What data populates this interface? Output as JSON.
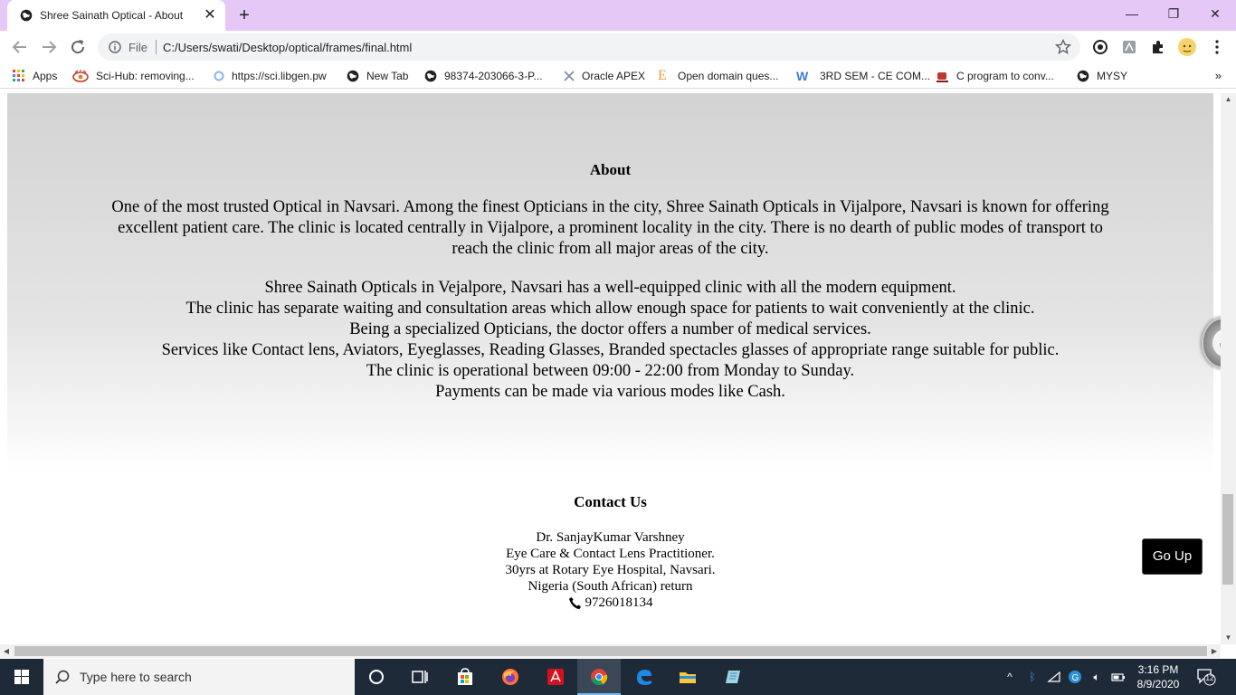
{
  "browser": {
    "tab_title": "Shree Sainath Optical - About",
    "url_scheme": "File",
    "url": "C:/Users/swati/Desktop/optical/frames/final.html"
  },
  "bookmarks": [
    {
      "label": "Apps",
      "icon": "apps-grid-icon"
    },
    {
      "label": "Sci-Hub: removing...",
      "icon": "scihub-icon"
    },
    {
      "label": "https://sci.libgen.pw",
      "icon": "libgen-icon"
    },
    {
      "label": "New Tab",
      "icon": "globe-icon"
    },
    {
      "label": "98374-203066-3-P...",
      "icon": "globe-icon"
    },
    {
      "label": "Oracle APEX",
      "icon": "apex-icon"
    },
    {
      "label": "Open domain ques...",
      "icon": "e-icon"
    },
    {
      "label": "3RD SEM - CE COM...",
      "icon": "w-icon"
    },
    {
      "label": "C program to conv...",
      "icon": "cup-icon"
    },
    {
      "label": "MYSY",
      "icon": "globe-icon"
    }
  ],
  "about": {
    "heading": "About",
    "paragraph1": "One of the most trusted Optical in Navsari. Among the finest Opticians in the city, Shree Sainath Opticals in Vijalpore, Navsari is known for offering excellent patient care. The clinic is located centrally in Vijalpore, a prominent locality in the city. There is no dearth of public modes of transport to reach the clinic from all major areas of the city.",
    "lines": [
      "Shree Sainath Opticals in Vejalpore, Navsari has a well-equipped clinic with all the modern equipment.",
      "The clinic has separate waiting and consultation areas which allow enough space for patients to wait conveniently at the clinic.",
      "Being a specialized Opticians, the doctor offers a number of medical services.",
      "Services like Contact lens, Aviators, Eyeglasses, Reading Glasses, Branded spectacles glasses of appropriate range suitable for public.",
      "The clinic is operational between 09:00 - 22:00 from Monday to Sunday.",
      "Payments can be made via various modes like Cash."
    ]
  },
  "contact": {
    "heading": "Contact Us",
    "lines": [
      "Dr. SanjayKumar Varshney",
      "Eye Care & Contact Lens Practitioner.",
      "30yrs at Rotary Eye Hospital, Navsari.",
      "Nigeria (South African) return"
    ],
    "phone": "9726018134"
  },
  "go_up_label": "Go Up",
  "taskbar": {
    "search_placeholder": "Type here to search",
    "time": "3:16 PM",
    "date": "8/9/2020",
    "notification_count": "12"
  }
}
